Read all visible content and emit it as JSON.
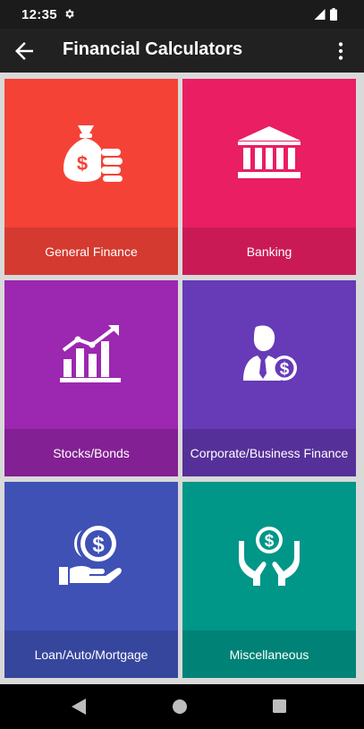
{
  "status_bar": {
    "time": "12:35",
    "icons": [
      "gear-icon",
      "signal-icon",
      "battery-icon"
    ]
  },
  "app_bar": {
    "title": "Financial Calculators",
    "back_icon": "arrow-back-icon",
    "menu_icon": "more-vert-icon"
  },
  "categories": [
    {
      "label": "General Finance",
      "icon": "money-bag-coins-icon",
      "color": "#f44336"
    },
    {
      "label": "Banking",
      "icon": "bank-building-icon",
      "color": "#e91e63"
    },
    {
      "label": "Stocks/Bonds",
      "icon": "bar-chart-trend-icon",
      "color": "#9c27b0"
    },
    {
      "label": "Corporate/Business Finance",
      "icon": "businessman-dollar-icon",
      "color": "#673ab7"
    },
    {
      "label": "Loan/Auto/Mortgage",
      "icon": "hand-dollar-coin-icon",
      "color": "#3f51b5"
    },
    {
      "label": "Miscellaneous",
      "icon": "hands-dollar-icon",
      "color": "#009688"
    }
  ],
  "nav_bar": {
    "icons": [
      "nav-back-icon",
      "nav-home-icon",
      "nav-recents-icon"
    ]
  }
}
